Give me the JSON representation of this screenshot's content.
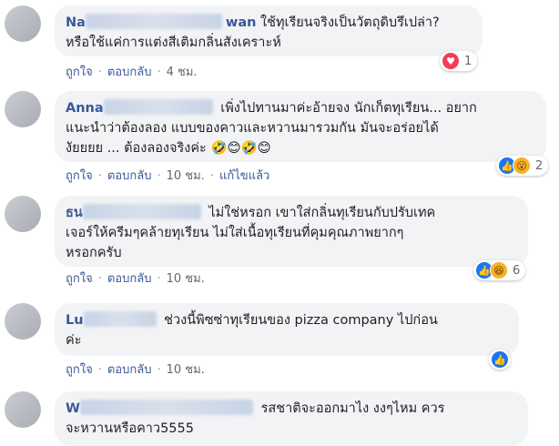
{
  "actions": {
    "like": "ถูกใจ",
    "reply": "ตอบกลับ",
    "edited": "แก้ไขแล้ว",
    "separator": "·"
  },
  "comments": [
    {
      "name_prefix": "Na",
      "name_suffix": "wan",
      "lines": [
        "ใช้ทุเรียนจริงเป็นวัตถุดิบรึเปล่า?",
        "หรือใช้แค่การแต่งสีเติมกลิ่นสังเคราะห์"
      ],
      "time": "4 ชม.",
      "reaction_count": "1",
      "reactions": [
        "love-reaction"
      ]
    },
    {
      "name_prefix": "Anna",
      "lines": [
        "เพิ่งไปทานมาค่ะอ้ายจง นักเก็ตทุเรียน... อยาก",
        "แนะนำว่าต้องลอง แบบของคาวและหวานมารวมกัน มันจะอร่อยได้",
        "งัยยยย ... ต้องลองจริงค่ะ"
      ],
      "emoji": "🤣😊🤣😊",
      "time": "10 ชม.",
      "reaction_count": "2",
      "reactions": [
        "like-reaction",
        "wow-reaction"
      ]
    },
    {
      "name_prefix": "ธน",
      "lines": [
        "ไม่ใช่หรอก เขาใส่กลิ่นทุเรียนกับปรับเทค",
        "เจอร์ให้ครีมๆคล้ายทุเรียน ไม่ใส่เนื้อทุเรียนที่คุมคุณภาพยากๆ",
        "หรอกครับ"
      ],
      "time": "10 ชม.",
      "reaction_count": "6",
      "reactions": [
        "like-reaction",
        "haha-reaction"
      ]
    },
    {
      "name_prefix": "Lu",
      "lines": [
        "ช่วงนี้พิซซ่าทุเรียนของ pizza company ไปก่อน",
        "ค่ะ"
      ],
      "time": "10 ชม.",
      "reactions": [
        "like-reaction"
      ]
    },
    {
      "name_prefix": "W",
      "lines": [
        "รสชาติจะออกมาไง งงๆไหม ควร",
        "จะหวานหรือคาว5555"
      ]
    }
  ]
}
